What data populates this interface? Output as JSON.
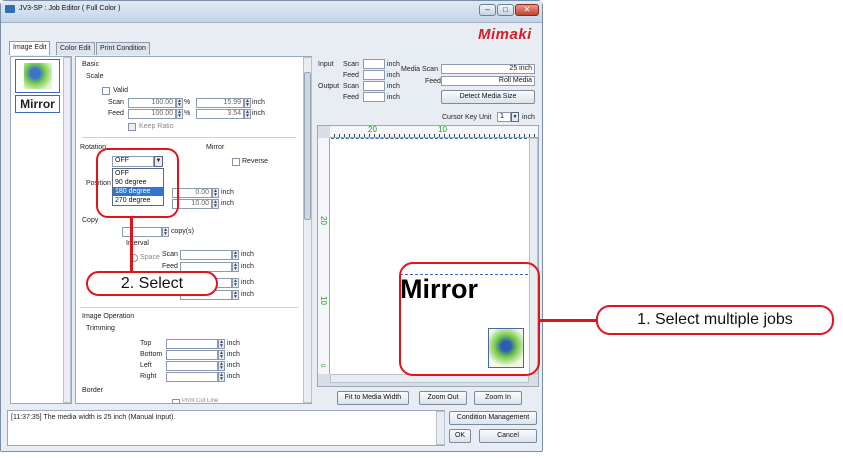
{
  "window": {
    "title": "JV3-SP : Job Editor ( Full Color )",
    "brand": "Mimaki",
    "min_glyph": "–",
    "max_glyph": "□",
    "close_glyph": "✕"
  },
  "tabs": [
    "Image Edit",
    "Color Edit",
    "Print Condition"
  ],
  "thumbnail": {
    "mirror_text": "Mirror"
  },
  "basic": {
    "section": "Basic",
    "scale_label": "Scale",
    "valid_label": "Valid",
    "scan_label": "Scan",
    "scan_value": "100.00",
    "scan_inch": "15.99",
    "feed_label": "Feed",
    "feed_value": "100.00",
    "feed_inch": "3.54",
    "percent": "%",
    "unit": "inch",
    "keep_ratio": "Keep Ratio",
    "rotation_label": "Rotation",
    "mirror_label": "Mirror",
    "reverse_label": "Reverse",
    "rotation_selected": "OFF",
    "rotation_options": [
      "OFF",
      "90 degree",
      "180 degree",
      "270 degree"
    ],
    "rotation_highlighted": "180 degree",
    "position_label": "Position",
    "pos_x": "0.00",
    "pos_y": "10.00",
    "copy_label": "Copy",
    "copy_unit": "copy(s)",
    "interval_label": "Interval",
    "space_label": "Space",
    "int_scan": "Scan",
    "int_feed": "Feed"
  },
  "image_operation": {
    "section": "Image Operation",
    "trimming": "Trimming",
    "top": "Top",
    "bottom": "Bottom",
    "left": "Left",
    "right": "Right",
    "border": "Border",
    "print_cut_line": "Print Cut Line"
  },
  "media": {
    "input_label": "Input",
    "output_label": "Output",
    "scan": "Scan",
    "feed": "Feed",
    "unit": "inch",
    "media_scan_label": "Media Scan",
    "media_scan_value": "25 inch",
    "media_feed_value": "Roll Media",
    "detect_button": "Detect Media Size",
    "cursor_key_unit_label": "Cursor Key Unit",
    "cursor_key_unit_value": "1",
    "cursor_key_unit_suffix": "inch"
  },
  "preview": {
    "ruler_top": [
      "20",
      "10"
    ],
    "ruler_left": [
      "20",
      "10",
      "0"
    ],
    "mirror_text": "Mirror",
    "fit_button": "Fit to Media Width",
    "zoom_out_button": "Zoom Out",
    "zoom_in_button": "Zoom In"
  },
  "status": {
    "message": "[11:37:35] The media width is 25 inch (Manual Input)."
  },
  "buttons": {
    "condition_management": "Condition Management",
    "ok": "OK",
    "cancel": "Cancel"
  },
  "callouts": {
    "select_jobs": "1. Select multiple jobs",
    "select": "2. Select"
  },
  "colors": {
    "callout_red": "#e1141b",
    "highlight_blue": "#3275d1",
    "ruler_green": "#1aa01a"
  }
}
